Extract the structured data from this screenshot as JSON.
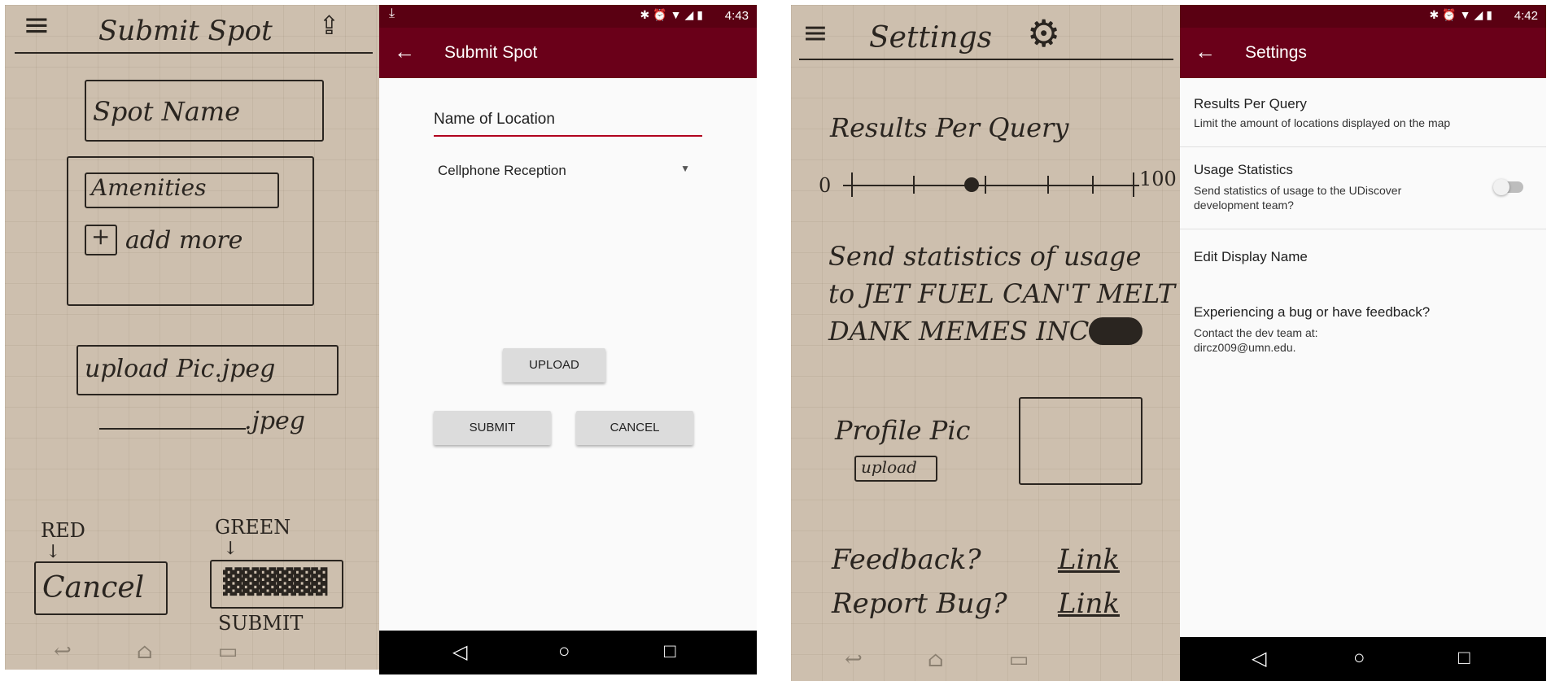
{
  "sketch1": {
    "title": "Submit Spot",
    "spot_name": "Spot Name",
    "amenities": "Amenities",
    "add_more": "add more",
    "plus": "+",
    "upload": "upload Pic.jpeg",
    "jpeg": ".jpeg",
    "red": "RED",
    "green": "GREEN",
    "cancel": "Cancel",
    "submit": "SUBMIT"
  },
  "screen1": {
    "status_time": "4:43",
    "title": "Submit Spot",
    "name_field": "Name of Location",
    "dropdown": "Cellphone Reception",
    "upload_btn": "UPLOAD",
    "submit_btn": "SUBMIT",
    "cancel_btn": "CANCEL"
  },
  "sketch2": {
    "title": "Settings",
    "results": "Results Per Query",
    "zero": "0",
    "hundred": "100",
    "stats": [
      "Send statistics of usage",
      "to JET FUEL CAN'T MELT",
      "DANK MEMES INC"
    ],
    "profile_pic": "Profile Pic",
    "upload": "upload",
    "feedback": "Feedback?",
    "report_bug": "Report Bug?",
    "link1": "Link",
    "link2": "Link"
  },
  "screen2": {
    "status_time": "4:42",
    "title": "Settings",
    "rows": [
      {
        "title": "Results Per Query",
        "subtitle": "Limit the amount of locations displayed on the map"
      },
      {
        "title": "Usage Statistics",
        "subtitle": "Send statistics of usage to the UDiscover development team?",
        "toggle": false
      },
      {
        "title": "Edit Display Name"
      },
      {
        "title": "Experiencing a bug or have feedback?",
        "subtitle": "Contact the dev team at: dircz009@umn.edu."
      }
    ]
  },
  "colors": {
    "appbar": "#6a0019",
    "statusbar": "#5a0012",
    "accent": "#b0001e"
  }
}
